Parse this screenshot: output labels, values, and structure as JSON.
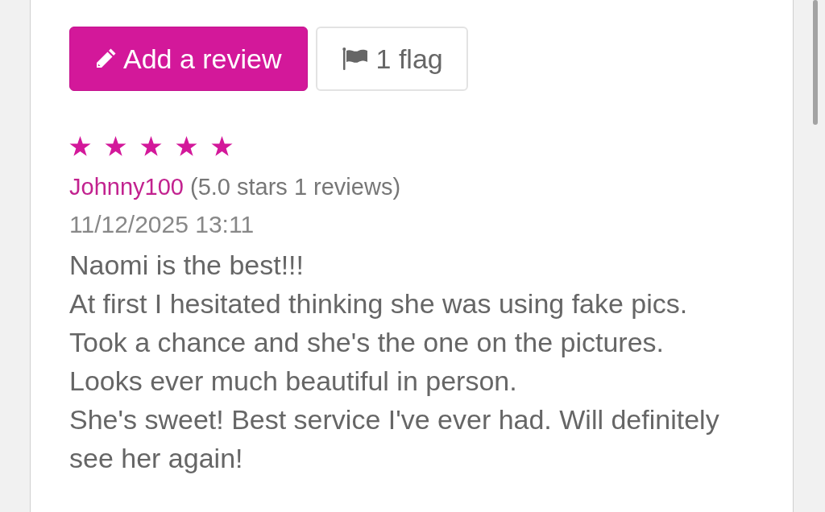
{
  "buttons": [
    {
      "kind": "add_review",
      "label": "Add a review"
    },
    {
      "kind": "flag",
      "label": "1 flag"
    }
  ],
  "review": {
    "stars": 5,
    "author": "Johnny100",
    "author_stats": "(5.0 stars 1 reviews)",
    "date": "11/12/2025 13:11",
    "lines": [
      "Naomi is the best!!!",
      "At first I hesitated thinking she was using fake pics.",
      "Took a chance and she's the one on the pictures.",
      "Looks ever much beautiful in person.",
      "She's sweet! Best service I've ever had. Will definitely see her again!"
    ]
  }
}
